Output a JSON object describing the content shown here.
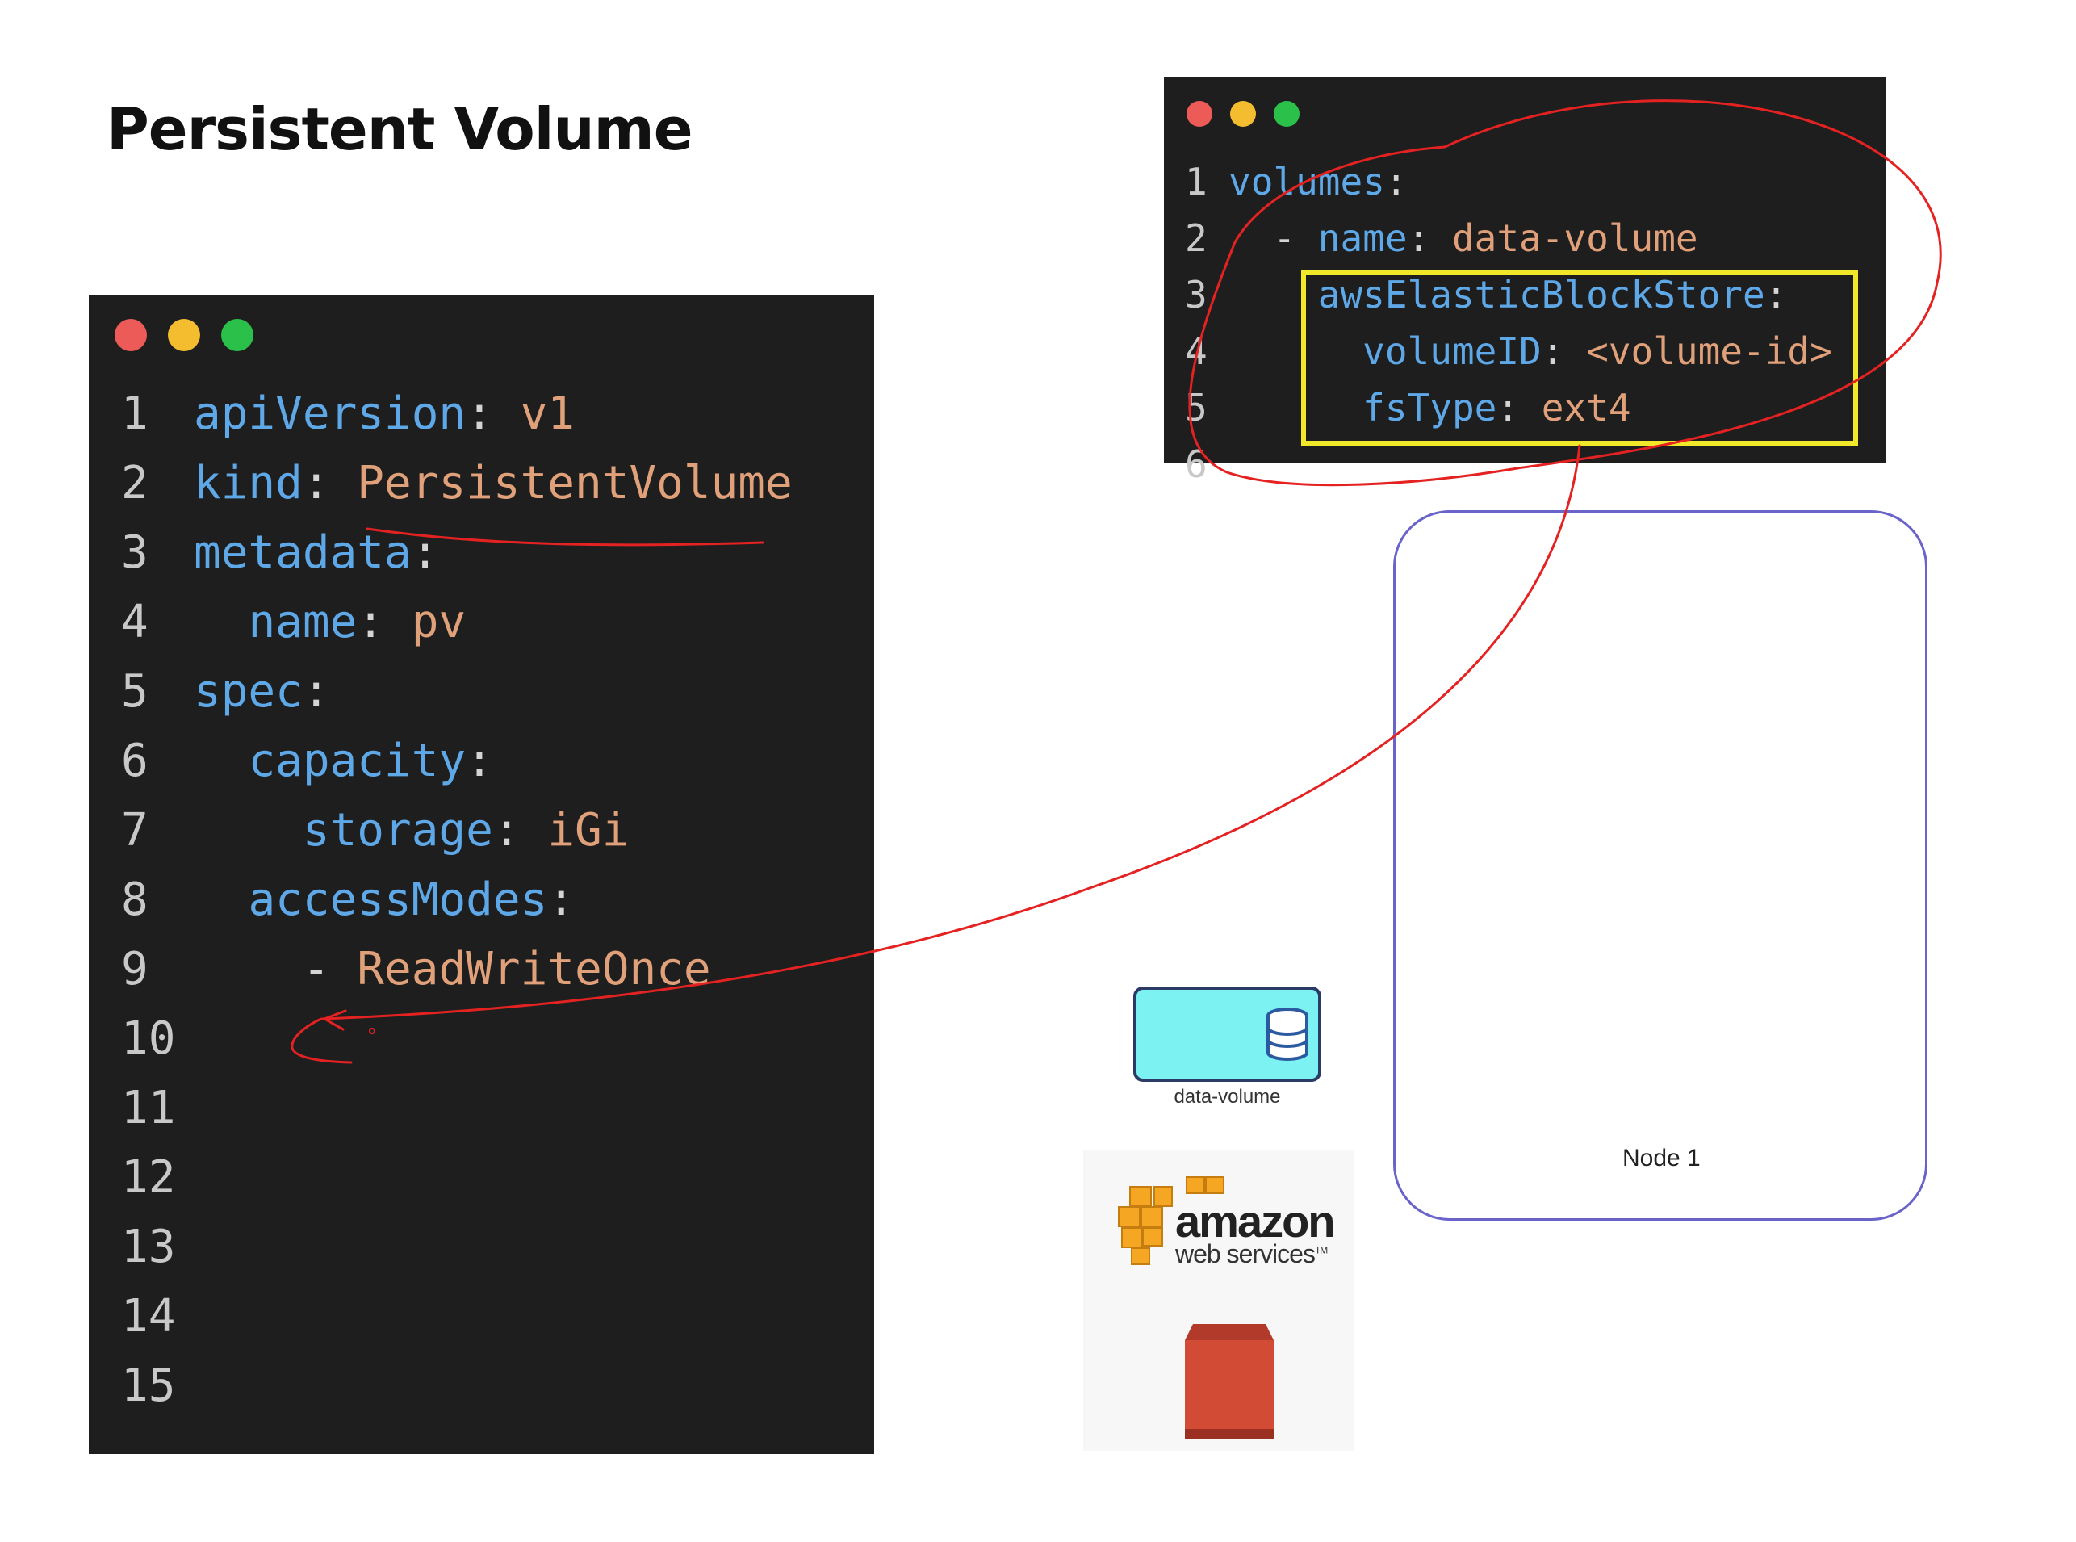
{
  "title": "Persistent Volume",
  "colors": {
    "editor_bg": "#1e1e1e",
    "key": "#5fa8e8",
    "value": "#e0a07a",
    "dot_red": "#ec5b58",
    "dot_yellow": "#f4bc2f",
    "dot_green": "#2bc04a",
    "highlight": "#f2e82a",
    "annotation": "#e52222",
    "node_border": "#6a63c9",
    "volume_fill": "#7df2f2"
  },
  "pv_editor": {
    "window_dots": [
      "red",
      "yellow",
      "green"
    ],
    "lines": [
      {
        "num": "1",
        "indent": "",
        "key": "apiVersion",
        "sep": ": ",
        "value": "v1"
      },
      {
        "num": "2",
        "indent": "",
        "key": "kind",
        "sep": ": ",
        "value": "PersistentVolume"
      },
      {
        "num": "3",
        "indent": "",
        "key": "metadata",
        "sep": ":",
        "value": ""
      },
      {
        "num": "4",
        "indent": "  ",
        "key": "name",
        "sep": ": ",
        "value": "pv"
      },
      {
        "num": "5",
        "indent": "",
        "key": "spec",
        "sep": ":",
        "value": ""
      },
      {
        "num": "6",
        "indent": "  ",
        "key": "capacity",
        "sep": ":",
        "value": ""
      },
      {
        "num": "7",
        "indent": "    ",
        "key": "storage",
        "sep": ": ",
        "value": "iGi"
      },
      {
        "num": "8",
        "indent": "  ",
        "key": "accessModes",
        "sep": ":",
        "value": ""
      },
      {
        "num": "9",
        "indent": "    ",
        "key": "",
        "sep": "- ",
        "value": "ReadWriteOnce"
      },
      {
        "num": "10",
        "indent": "",
        "key": "",
        "sep": "",
        "value": ""
      },
      {
        "num": "11",
        "indent": "",
        "key": "",
        "sep": "",
        "value": ""
      },
      {
        "num": "12",
        "indent": "",
        "key": "",
        "sep": "",
        "value": ""
      },
      {
        "num": "13",
        "indent": "",
        "key": "",
        "sep": "",
        "value": ""
      },
      {
        "num": "14",
        "indent": "",
        "key": "",
        "sep": "",
        "value": ""
      },
      {
        "num": "15",
        "indent": "",
        "key": "",
        "sep": "",
        "value": ""
      }
    ]
  },
  "pod_editor": {
    "window_dots": [
      "red",
      "yellow",
      "green"
    ],
    "lines": [
      {
        "num": "1",
        "indent": "",
        "key": "volumes",
        "sep": ":",
        "value": ""
      },
      {
        "num": "2",
        "indent": "  ",
        "key": "name",
        "sep": ": ",
        "value": "data-volume",
        "dash": "- "
      },
      {
        "num": "3",
        "indent": "    ",
        "key": "awsElasticBlockStore",
        "sep": ":",
        "value": ""
      },
      {
        "num": "4",
        "indent": "      ",
        "key": "volumeID",
        "sep": ": ",
        "value": "<volume-id>"
      },
      {
        "num": "5",
        "indent": "      ",
        "key": "fsType",
        "sep": ": ",
        "value": "ext4"
      },
      {
        "num": "6",
        "indent": "",
        "key": "",
        "sep": "",
        "value": ""
      }
    ]
  },
  "diagram": {
    "volume_label": "data-volume",
    "volume_icon": "database-icon",
    "node_label": "Node 1",
    "aws_logo_text": "amazon",
    "aws_logo_subtext": "web services",
    "aws_logo_tm": "TM",
    "aws_service_icon": "ebs-volume-icon"
  }
}
